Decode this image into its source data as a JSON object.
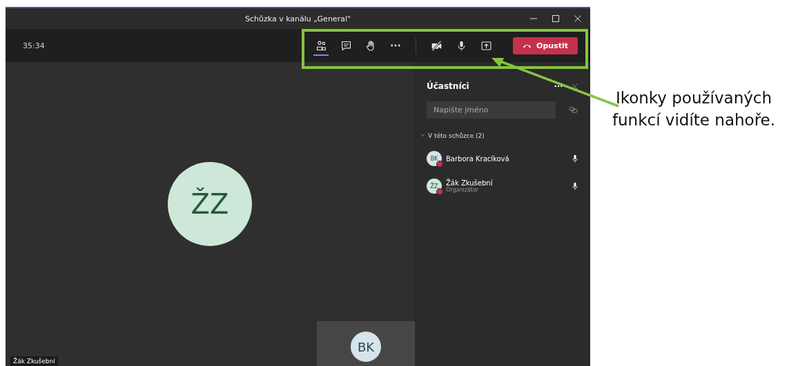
{
  "window": {
    "title": "Schůzka v kanálu „General\""
  },
  "toolbar": {
    "timer": "35:34",
    "buttons": [
      {
        "kind": "people",
        "selected": true
      },
      {
        "kind": "chat",
        "selected": false
      },
      {
        "kind": "hand",
        "selected": false
      },
      {
        "kind": "more",
        "selected": false
      },
      {
        "kind": "divider"
      },
      {
        "kind": "camera-off",
        "selected": false
      },
      {
        "kind": "mic",
        "selected": false
      },
      {
        "kind": "share",
        "selected": false
      }
    ],
    "leave_button": "Opustit"
  },
  "stage": {
    "avatar_initials": "ŽZ",
    "name_label": "Žák Zkušební",
    "thumbnail_initials": "BK"
  },
  "participants_panel": {
    "title": "Účastníci",
    "search": {
      "placeholder": "Napište jméno"
    },
    "section": "V této schůzce (2)",
    "participants": [
      {
        "initials": "BK",
        "name": "Barbora Kracíková",
        "color": "#d6e4eb"
      },
      {
        "initials": "ŽZ",
        "name": "Žák Zkušební",
        "role": "Organizátor",
        "color": "#cde8d8"
      }
    ]
  },
  "annotation": {
    "text": "Ikonky používaných funkcí vidíte nahoře."
  }
}
